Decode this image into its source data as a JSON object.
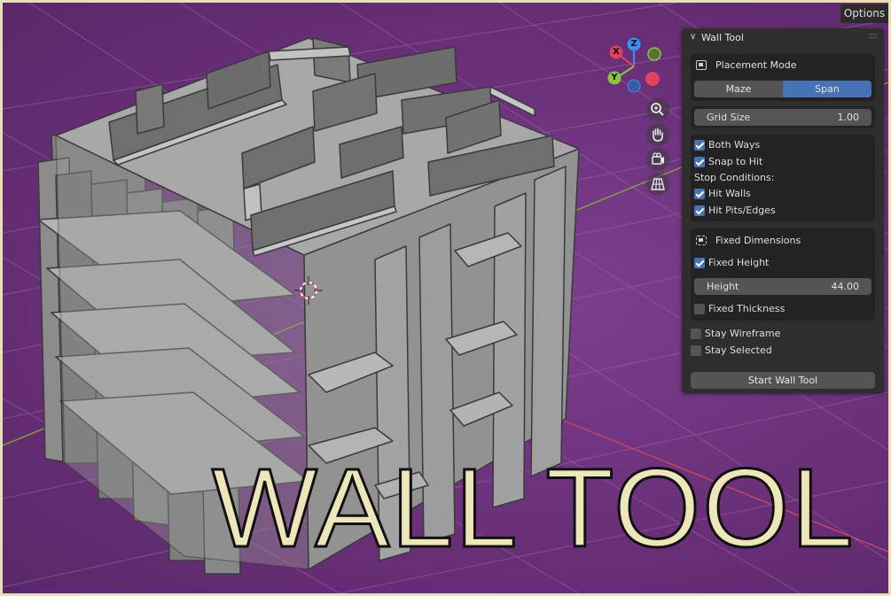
{
  "viewport": {
    "options_label": "Options",
    "gizmo": {
      "x_label": "X",
      "y_label": "Y",
      "z_label": "Z"
    },
    "nav_icons": [
      "zoom-icon",
      "hand-pan-icon",
      "camera-icon",
      "grid-view-icon"
    ],
    "overlay_title": "WALL TOOL"
  },
  "panel": {
    "title": "Wall Tool",
    "placement": {
      "label": "Placement Mode",
      "modes": [
        "Maze",
        "Span"
      ],
      "selected": "Span"
    },
    "grid_size": {
      "label": "Grid Size",
      "value": "1.00"
    },
    "options": {
      "both_ways": {
        "label": "Both Ways",
        "checked": true
      },
      "snap_to_hit": {
        "label": "Snap to Hit",
        "checked": true
      },
      "stop_conditions_label": "Stop Conditions:",
      "hit_walls": {
        "label": "Hit Walls",
        "checked": true
      },
      "hit_pits": {
        "label": "Hit Pits/Edges",
        "checked": true
      }
    },
    "fixed_dimensions": {
      "label": "Fixed Dimensions",
      "fixed_height": {
        "label": "Fixed Height",
        "checked": true
      },
      "height": {
        "label": "Height",
        "value": "44.00"
      },
      "fixed_thickness": {
        "label": "Fixed Thickness",
        "checked": false
      }
    },
    "stay_wireframe": {
      "label": "Stay Wireframe",
      "checked": false
    },
    "stay_selected": {
      "label": "Stay Selected",
      "checked": false
    },
    "start_button": "Start Wall Tool"
  },
  "colors": {
    "background": "#6a3079",
    "accent": "#4772b3",
    "wall": "#a5a5a5",
    "title_fill": "#ede6bb",
    "axis_x": "#e0435e",
    "axis_y": "#8cc63f",
    "axis_z": "#3c8ef0"
  }
}
